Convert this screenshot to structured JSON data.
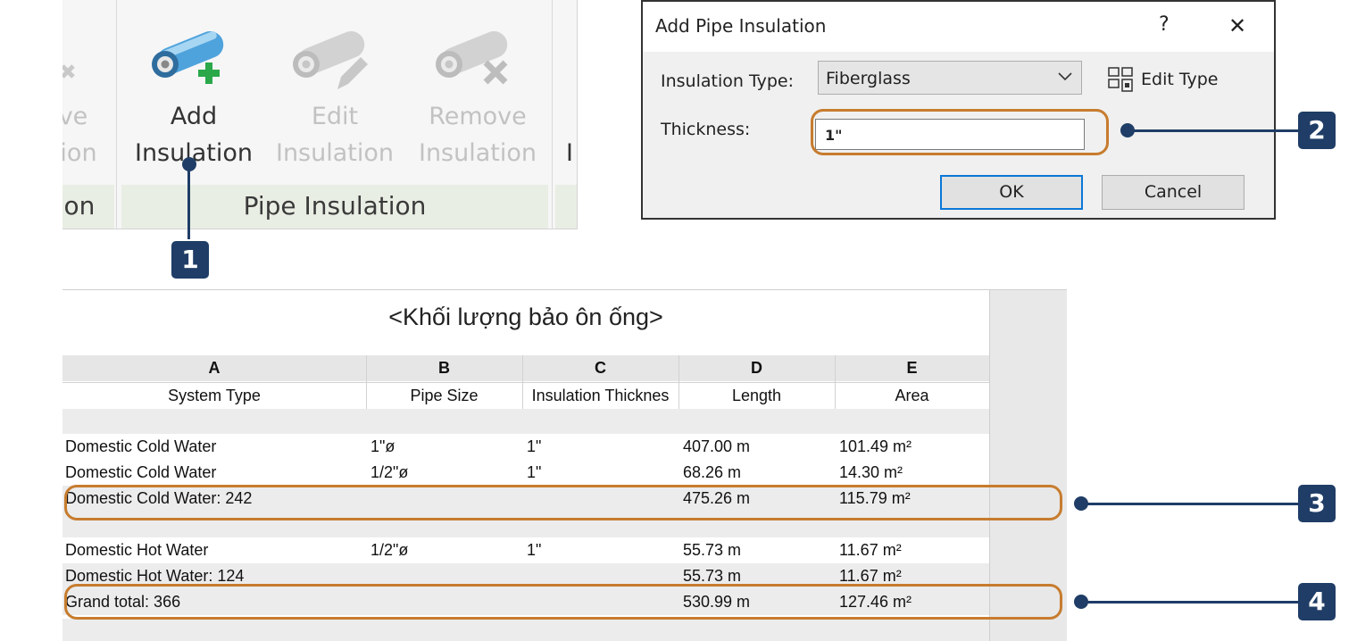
{
  "ribbon": {
    "left_partial_top": "ve",
    "left_partial_bottom": "ion",
    "left_panel_partial": "on",
    "add": {
      "line1": "Add",
      "line2": "Insulation"
    },
    "edit": {
      "line1": "Edit",
      "line2": "Insulation"
    },
    "remove": {
      "line1": "Remove",
      "line2": "Insulation"
    },
    "right_partial": "I",
    "panel_title": "Pipe Insulation",
    "icons": [
      "add-insulation-icon",
      "edit-insulation-icon",
      "remove-insulation-icon"
    ]
  },
  "callouts": [
    "1",
    "2",
    "3",
    "4"
  ],
  "dialog": {
    "title": "Add Pipe Insulation",
    "help": "?",
    "close": "✕",
    "insulation_type_label": "Insulation Type:",
    "insulation_type_value": "Fiberglass",
    "edit_type": "Edit Type",
    "thickness_label": "Thickness:",
    "thickness_value": "1\"",
    "ok": "OK",
    "cancel": "Cancel"
  },
  "schedule": {
    "title": "<Khối lượng bảo ôn ống>",
    "letters": [
      "A",
      "B",
      "C",
      "D",
      "E"
    ],
    "headers": [
      "System Type",
      "Pipe Size",
      "Insulation Thicknes",
      "Length",
      "Area"
    ],
    "rows": [
      [
        "Domestic Cold Water",
        "1\"ø",
        "1\"",
        "407.00 m",
        "101.49 m²"
      ],
      [
        "Domestic Cold Water",
        "1/2\"ø",
        "1\"",
        "68.26 m",
        "14.30 m²"
      ],
      [
        "Domestic Cold Water: 242",
        "",
        "",
        "475.26 m",
        "115.79 m²"
      ],
      [
        "Domestic Hot Water",
        "1/2\"ø",
        "1\"",
        "55.73 m",
        "11.67 m²"
      ],
      [
        "Domestic Hot Water: 124",
        "",
        "",
        "55.73 m",
        "11.67 m²"
      ],
      [
        "Grand total: 366",
        "",
        "",
        "530.99 m",
        "127.46 m²"
      ]
    ]
  },
  "colors": {
    "accent": "#1f3d66",
    "highlight": "#c77c2e",
    "focus": "#0a78d7"
  }
}
